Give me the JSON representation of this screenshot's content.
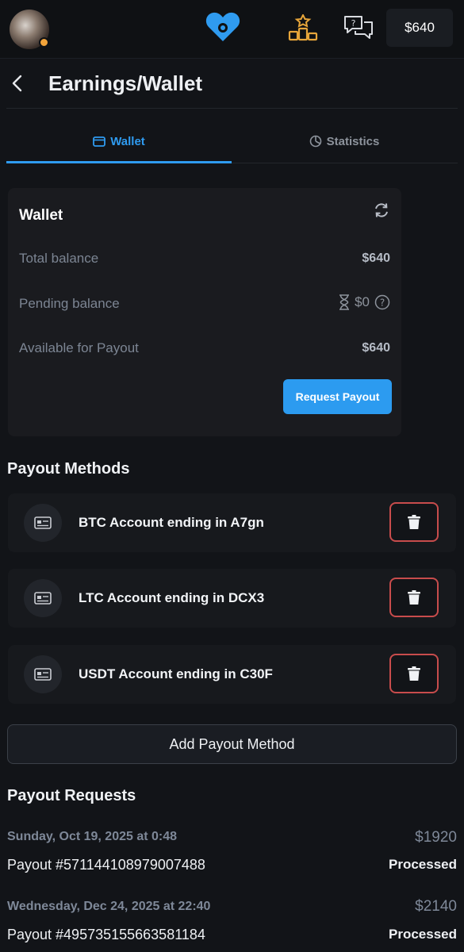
{
  "header": {
    "balance": "$640",
    "accent_color": "#2f9bf0"
  },
  "page": {
    "title": "Earnings/Wallet"
  },
  "tabs": [
    {
      "label": "Wallet",
      "active": true
    },
    {
      "label": "Statistics",
      "active": false
    }
  ],
  "wallet": {
    "title": "Wallet",
    "rows": [
      {
        "label": "Total balance",
        "value": "$640"
      },
      {
        "label": "Pending balance",
        "value": "$0"
      },
      {
        "label": "Available for Payout",
        "value": "$640"
      }
    ],
    "request_button": "Request Payout"
  },
  "payout_methods": {
    "title": "Payout Methods",
    "items": [
      {
        "label": "BTC Account ending in A7gn"
      },
      {
        "label": "LTC Account ending in DCX3"
      },
      {
        "label": "USDT Account ending in C30F"
      }
    ],
    "add_button": "Add Payout Method"
  },
  "payout_requests": {
    "title": "Payout Requests",
    "items": [
      {
        "date": "Sunday, Oct 19, 2025 at 0:48",
        "amount": "$1920",
        "id": "Payout #571144108979007488",
        "status": "Processed"
      },
      {
        "date": "Wednesday, Dec 24, 2025 at 22:40",
        "amount": "$2140",
        "id": "Payout #495735155663581184",
        "status": "Processed"
      }
    ]
  }
}
